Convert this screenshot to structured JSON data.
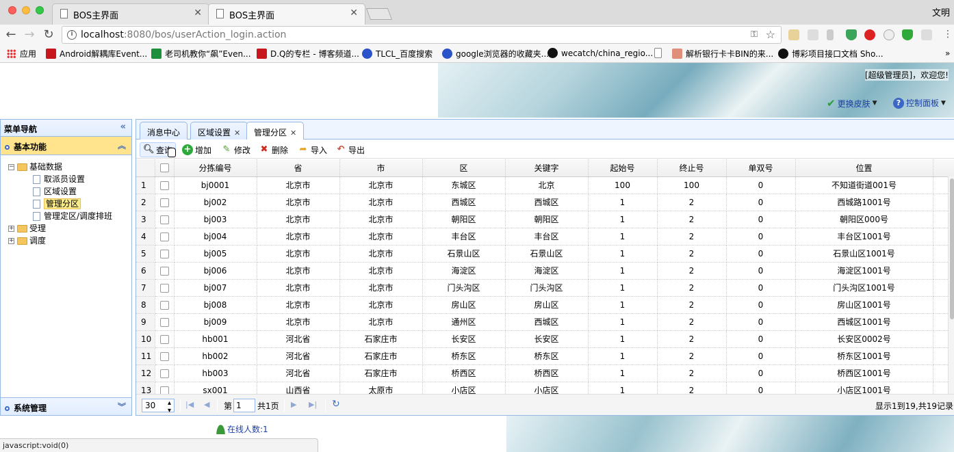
{
  "browser": {
    "tabs": [
      {
        "title": "BOS主界面",
        "active": false
      },
      {
        "title": "BOS主界面",
        "active": true
      }
    ],
    "profile_label": "文明",
    "url_host": "localhost",
    "url_rest": ":8080/bos/userAction_login.action",
    "bookmarks": [
      {
        "label": "应用",
        "icon": "apps-grid-icon"
      },
      {
        "label": "Android解耦库Event...",
        "icon": "csdn-icon"
      },
      {
        "label": "老司机教你“飙”Even...",
        "icon": "segmentfault-icon"
      },
      {
        "label": "D.Q的专栏 - 博客频道...",
        "icon": "csdn-icon"
      },
      {
        "label": "TLCL_百度搜索",
        "icon": "baidu-paw-icon"
      },
      {
        "label": "google浏览器的收藏夹...",
        "icon": "baidu-paw-icon"
      },
      {
        "label": "wecatch/china_regio...",
        "icon": "github-icon"
      },
      {
        "label": "",
        "icon": "blank-page-icon"
      },
      {
        "label": "解析银行卡卡BIN的来...",
        "icon": "jianshu-icon"
      },
      {
        "label": "博彩项目接口文档 Sho...",
        "icon": "swagger-icon"
      }
    ]
  },
  "header": {
    "welcome": "[超级管理员]，欢迎您!",
    "skin_label": "更换皮肤",
    "panel_label": "控制面板"
  },
  "nav": {
    "title": "菜单导航",
    "section_basic": "基本功能",
    "tree": {
      "root": "基础数据",
      "leaves": [
        "取派员设置",
        "区域设置",
        "管理分区",
        "管理定区/调度排班"
      ],
      "selected": "管理分区",
      "other_roots": [
        "受理",
        "调度"
      ]
    },
    "section_system": "系统管理"
  },
  "content_tabs": [
    {
      "label": "消息中心",
      "closable": false,
      "active": false
    },
    {
      "label": "区域设置",
      "closable": true,
      "active": false
    },
    {
      "label": "管理分区",
      "closable": true,
      "active": true
    }
  ],
  "toolbar": {
    "search": "查询",
    "add": "增加",
    "edit": "修改",
    "delete": "删除",
    "import": "导入",
    "export": "导出"
  },
  "grid": {
    "columns": [
      "分拣编号",
      "省",
      "市",
      "区",
      "关键字",
      "起始号",
      "终止号",
      "单双号",
      "位置"
    ],
    "rows": [
      [
        "1",
        "bj0001",
        "北京市",
        "北京市",
        "东城区",
        "北京",
        "100",
        "100",
        "0",
        "不知道街道001号"
      ],
      [
        "2",
        "bj002",
        "北京市",
        "北京市",
        "西城区",
        "西城区",
        "1",
        "2",
        "0",
        "西城路1001号"
      ],
      [
        "3",
        "bj003",
        "北京市",
        "北京市",
        "朝阳区",
        "朝阳区",
        "1",
        "2",
        "0",
        "朝阳区000号"
      ],
      [
        "4",
        "bj004",
        "北京市",
        "北京市",
        "丰台区",
        "丰台区",
        "1",
        "2",
        "0",
        "丰台区1001号"
      ],
      [
        "5",
        "bj005",
        "北京市",
        "北京市",
        "石景山区",
        "石景山区",
        "1",
        "2",
        "0",
        "石景山区1001号"
      ],
      [
        "6",
        "bj006",
        "北京市",
        "北京市",
        "海淀区",
        "海淀区",
        "1",
        "2",
        "0",
        "海淀区1001号"
      ],
      [
        "7",
        "bj007",
        "北京市",
        "北京市",
        "门头沟区",
        "门头沟区",
        "1",
        "2",
        "0",
        "门头沟区1001号"
      ],
      [
        "8",
        "bj008",
        "北京市",
        "北京市",
        "房山区",
        "房山区",
        "1",
        "2",
        "0",
        "房山区1001号"
      ],
      [
        "9",
        "bj009",
        "北京市",
        "北京市",
        "通州区",
        "西城区",
        "1",
        "2",
        "0",
        "西城区1001号"
      ],
      [
        "10",
        "hb001",
        "河北省",
        "石家庄市",
        "长安区",
        "长安区",
        "1",
        "2",
        "0",
        "长安区0002号"
      ],
      [
        "11",
        "hb002",
        "河北省",
        "石家庄市",
        "桥东区",
        "桥东区",
        "1",
        "2",
        "0",
        "桥东区1001号"
      ],
      [
        "12",
        "hb003",
        "河北省",
        "石家庄市",
        "桥西区",
        "桥西区",
        "1",
        "2",
        "0",
        "桥西区1001号"
      ],
      [
        "13",
        "sx001",
        "山西省",
        "太原市",
        "小店区",
        "小店区",
        "1",
        "2",
        "0",
        "小店区1001号"
      ]
    ]
  },
  "pager": {
    "page_size": "30",
    "page_prefix": "第",
    "page_value": "1",
    "page_suffix": "共1页",
    "info": "显示1到19,共19记录"
  },
  "footer": {
    "online": "在线人数:1",
    "status": "javascript:void(0)"
  }
}
